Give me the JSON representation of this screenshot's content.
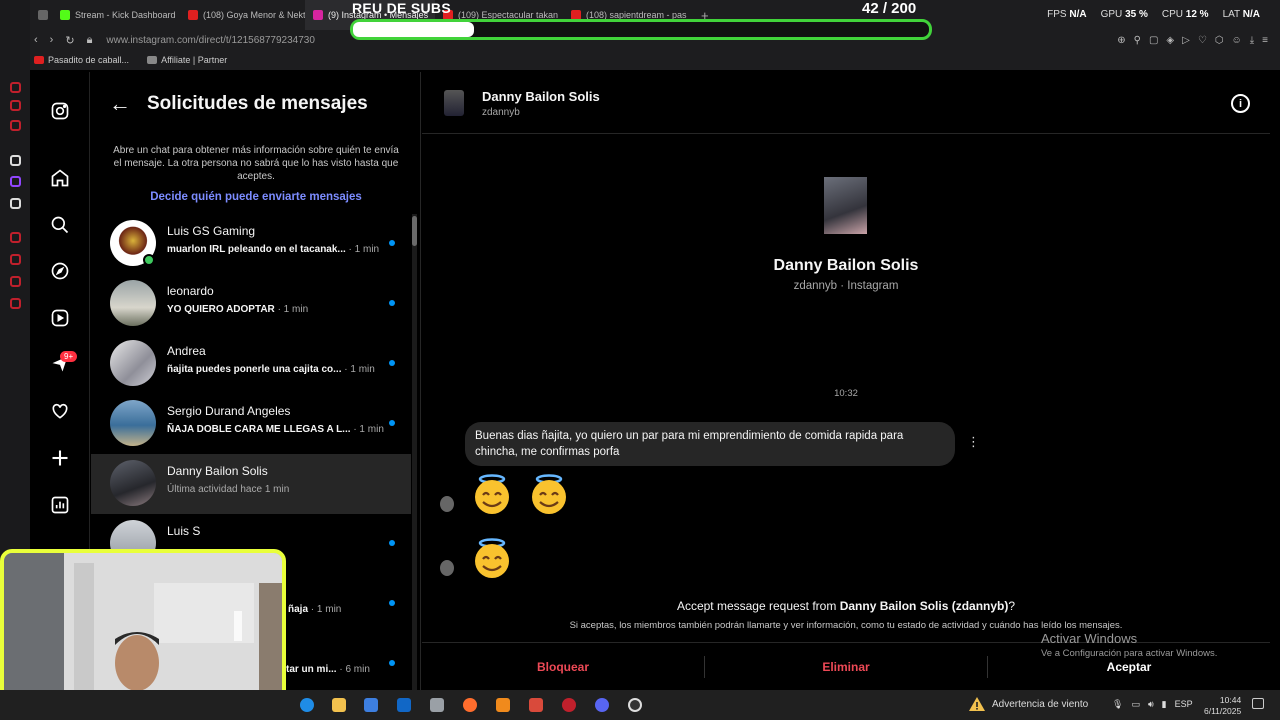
{
  "browser": {
    "tabs": [
      {
        "label": "",
        "color": "#c0202c"
      },
      {
        "label": "",
        "color": "#888888"
      },
      {
        "label": "Stream - Kick Dashboard",
        "color": "#53fc18"
      },
      {
        "label": "(108) Goya Menor & Nekt",
        "color": "#e02020"
      },
      {
        "label": "(9) Instagram • Mensajes",
        "color": "#d6249f",
        "active": true
      },
      {
        "label": "(109) Espectacular takan",
        "color": "#e02020"
      },
      {
        "label": "(108) sapientdream - pas",
        "color": "#e02020"
      }
    ],
    "stats": {
      "fps_label": "FPS",
      "fps": "N/A",
      "gpu_label": "GPU",
      "gpu": "35 %",
      "cpu_label": "CPU",
      "cpu": "12 %",
      "lat_label": "LAT",
      "lat": "N/A"
    },
    "url": "www.instagram.com/direct/t/121568779234730",
    "bookmarks": [
      "Pasadito de caball...",
      "Affiliate | Partner"
    ]
  },
  "overlay": {
    "title": "REU DE SUBS",
    "count": "42  / 200",
    "progress": 0.21,
    "accent": "#41d33a"
  },
  "ig_nav": {
    "icons": [
      "instagram-logo-icon",
      "home-icon",
      "search-icon",
      "explore-icon",
      "reels-icon",
      "messages-icon",
      "heart-icon",
      "create-icon",
      "dashboard-icon"
    ],
    "badge": "9+"
  },
  "requests": {
    "title": "Solicitudes de mensajes",
    "info": "Abre un chat para obtener más información sobre quién te envía el mensaje. La otra persona no sabrá que lo has visto hasta que aceptes.",
    "link": "Decide quién puede enviarte mensajes",
    "items": [
      {
        "name": "Luis GS Gaming",
        "preview": "muarlon IRL peleando en el tacanak...",
        "time": "· 1 min",
        "unread": true,
        "online": true
      },
      {
        "name": "leonardo",
        "preview": "YO QUIERO ADOPTAR",
        "time": "· 1 min",
        "unread": true
      },
      {
        "name": "Andrea",
        "preview": "ñajita puedes ponerle una cajita co...",
        "time": "· 1 min",
        "unread": true
      },
      {
        "name": "Sergio Durand Angeles",
        "preview": "ÑAJA DOBLE CARA ME LLEGAS A L...",
        "time": "· 1 min",
        "unread": true
      },
      {
        "name": "Danny Bailon Solis",
        "preview": "Última actividad hace 1 min",
        "time": "",
        "selected": true
      },
      {
        "name": "Luis S",
        "preview": "",
        "time": "",
        "unread": true
      },
      {
        "name": "",
        "preview": "ñaja",
        "time": "· 1 min",
        "unread": true
      },
      {
        "name": "",
        "preview": "tar un mi...",
        "time": "· 6 min",
        "unread": true
      }
    ]
  },
  "conversation": {
    "name": "Danny Bailon Solis",
    "username": "zdannyb",
    "profile_sub": "zdannyb · Instagram",
    "timestamp": "10:32",
    "message": "Buenas dias ñajita, yo quiero un par para mi emprendimiento de comida rapida para chincha, me confirmas porfa",
    "emojis": [
      "😇",
      "😇",
      "😇"
    ],
    "accept_prefix": "Accept message request from ",
    "accept_name": "Danny Bailon Solis (zdannyb)",
    "accept_suffix": "?",
    "accept_note": "Si aceptas, los miembros también podrán llamarte y ver información, como tu estado de actividad y cuándo has leído los mensajes.",
    "actions": {
      "block": "Bloquear",
      "delete": "Eliminar",
      "accept": "Aceptar"
    }
  },
  "windows": {
    "watermark_title": "Activar Windows",
    "watermark_sub": "Ve a Configuración para activar Windows.",
    "weather": "Advertencia de viento",
    "lang": "ESP",
    "time": "10:44",
    "date": "6/11/2025"
  }
}
